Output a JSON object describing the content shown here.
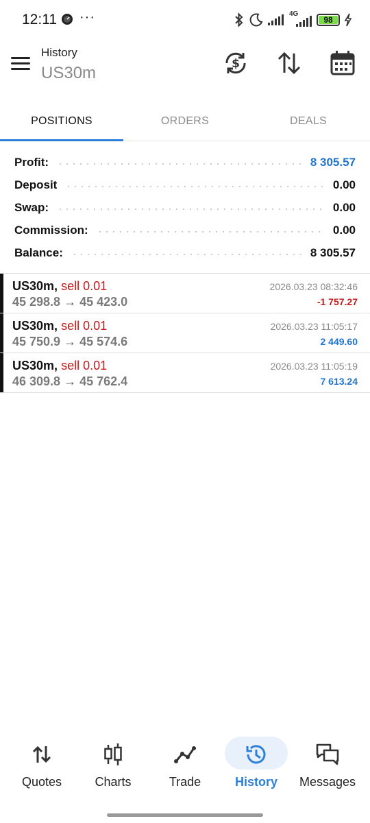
{
  "status_bar": {
    "time": "12:11",
    "more": "···",
    "network": "4G",
    "battery": "98"
  },
  "header": {
    "title": "History",
    "subtitle": "US30m"
  },
  "tabs": [
    {
      "label": "POSITIONS",
      "active": true
    },
    {
      "label": "ORDERS",
      "active": false
    },
    {
      "label": "DEALS",
      "active": false
    }
  ],
  "summary": {
    "profit": {
      "label": "Profit:",
      "value": "8 305.57"
    },
    "deposit": {
      "label": "Deposit",
      "value": "0.00"
    },
    "swap": {
      "label": "Swap:",
      "value": "0.00"
    },
    "commission": {
      "label": "Commission:",
      "value": "0.00"
    },
    "balance": {
      "label": "Balance:",
      "value": "8 305.57"
    }
  },
  "positions": [
    {
      "symbol": "US30m,",
      "type": "sell 0.01",
      "open": "45 298.8",
      "arrow": "→",
      "close": "45 423.0",
      "time": "2026.03.23 08:32:46",
      "profit": "-1 757.27"
    },
    {
      "symbol": "US30m,",
      "type": "sell 0.01",
      "open": "45 750.9",
      "arrow": "→",
      "close": "45 574.6",
      "time": "2026.03.23 11:05:17",
      "profit": "2 449.60"
    },
    {
      "symbol": "US30m,",
      "type": "sell 0.01",
      "open": "46 309.8",
      "arrow": "→",
      "close": "45 762.4",
      "time": "2026.03.23 11:05:19",
      "profit": "7 613.24"
    }
  ],
  "bottom_nav": [
    {
      "label": "Quotes",
      "icon": "quotes-arrows-icon",
      "active": false
    },
    {
      "label": "Charts",
      "icon": "candlestick-icon",
      "active": false
    },
    {
      "label": "Trade",
      "icon": "trade-line-icon",
      "active": false
    },
    {
      "label": "History",
      "icon": "history-clock-icon",
      "active": true
    },
    {
      "label": "Messages",
      "icon": "messages-icon",
      "active": false
    }
  ],
  "colors": {
    "accent": "#2d7fd8",
    "profit_positive": "#1f74cf",
    "profit_negative": "#c51a1a"
  }
}
